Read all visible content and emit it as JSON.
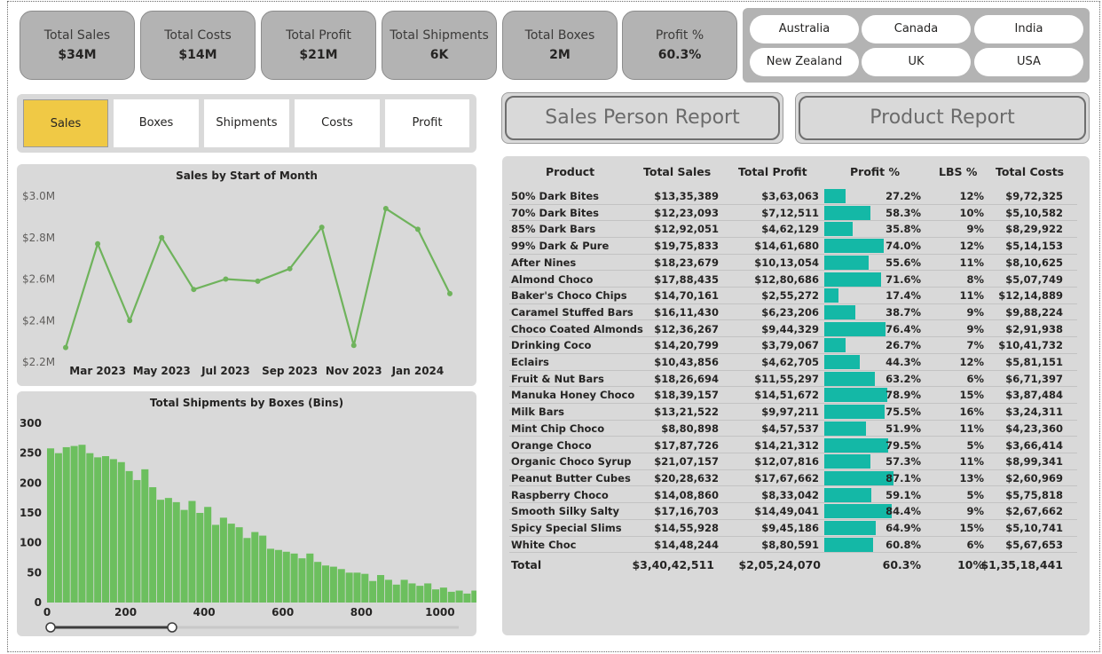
{
  "kpis": [
    {
      "label": "Total Sales",
      "value": "$34M"
    },
    {
      "label": "Total Costs",
      "value": "$14M"
    },
    {
      "label": "Total Profit",
      "value": "$21M"
    },
    {
      "label": "Total Shipments",
      "value": "6K"
    },
    {
      "label": "Total Boxes",
      "value": "2M"
    },
    {
      "label": "Profit %",
      "value": "60.3%"
    }
  ],
  "countries": [
    "Australia",
    "Canada",
    "India",
    "New Zealand",
    "UK",
    "USA"
  ],
  "metric_tabs": [
    "Sales",
    "Boxes",
    "Shipments",
    "Costs",
    "Profit"
  ],
  "active_tab": "Sales",
  "nav": {
    "sales_person": "Sales Person Report",
    "product": "Product Report"
  },
  "colors": {
    "line": "#6fb35c",
    "bar": "#6cbf5e",
    "profit_bar": "#14b8a6",
    "active_tab": "#f0c945"
  },
  "chart_data": [
    {
      "type": "line",
      "title": "Sales by Start of Month",
      "x": [
        "Feb 2023",
        "Mar 2023",
        "Apr 2023",
        "May 2023",
        "Jun 2023",
        "Jul 2023",
        "Aug 2023",
        "Sep 2023",
        "Oct 2023",
        "Nov 2023",
        "Dec 2023",
        "Jan 2024",
        "Feb 2024"
      ],
      "x_tick_labels": [
        "Mar 2023",
        "May 2023",
        "Jul 2023",
        "Sep 2023",
        "Nov 2023",
        "Jan 2024"
      ],
      "values": [
        2.27,
        2.77,
        2.4,
        2.8,
        2.55,
        2.6,
        2.59,
        2.65,
        2.85,
        2.28,
        2.94,
        2.84,
        2.53
      ],
      "y_tick_labels": [
        "$2.2M",
        "$2.4M",
        "$2.6M",
        "$2.8M",
        "$3.0M"
      ],
      "ylim": [
        2.2,
        3.0
      ],
      "grid": false
    },
    {
      "type": "bar",
      "title": "Total Shipments by Boxes (Bins)",
      "bin_width": 20,
      "x_start": 0,
      "values": [
        258,
        250,
        260,
        262,
        264,
        250,
        243,
        245,
        240,
        235,
        220,
        205,
        223,
        193,
        172,
        175,
        168,
        155,
        170,
        150,
        160,
        130,
        142,
        132,
        126,
        108,
        118,
        112,
        90,
        88,
        85,
        82,
        74,
        82,
        68,
        62,
        60,
        56,
        50,
        50,
        48,
        36,
        46,
        38,
        30,
        38,
        32,
        28,
        32,
        22,
        25,
        18,
        20,
        15,
        20,
        20,
        18,
        16,
        15,
        14,
        12,
        14,
        5,
        12
      ],
      "x_tick_labels": [
        "0",
        "200",
        "400",
        "600",
        "800",
        "1000"
      ],
      "x_ticks": [
        0,
        200,
        400,
        600,
        800,
        1000
      ],
      "y_tick_labels": [
        "0",
        "50",
        "100",
        "150",
        "200",
        "250",
        "300"
      ],
      "ylim": [
        0,
        300
      ]
    },
    {
      "type": "table",
      "columns": [
        "Product",
        "Total Sales",
        "Total Profit",
        "Profit %",
        "LBS %",
        "Total Costs"
      ],
      "rows": [
        {
          "product": "50% Dark Bites",
          "sales": "$13,35,389",
          "profit": "$3,63,063",
          "pct": "27.2%",
          "pct_val": 27.2,
          "lbs": "12%",
          "costs": "$9,72,325"
        },
        {
          "product": "70% Dark Bites",
          "sales": "$12,23,093",
          "profit": "$7,12,511",
          "pct": "58.3%",
          "pct_val": 58.3,
          "lbs": "10%",
          "costs": "$5,10,582"
        },
        {
          "product": "85% Dark Bars",
          "sales": "$12,92,051",
          "profit": "$4,62,129",
          "pct": "35.8%",
          "pct_val": 35.8,
          "lbs": "9%",
          "costs": "$8,29,922"
        },
        {
          "product": "99% Dark & Pure",
          "sales": "$19,75,833",
          "profit": "$14,61,680",
          "pct": "74.0%",
          "pct_val": 74.0,
          "lbs": "12%",
          "costs": "$5,14,153"
        },
        {
          "product": "After Nines",
          "sales": "$18,23,679",
          "profit": "$10,13,054",
          "pct": "55.6%",
          "pct_val": 55.6,
          "lbs": "11%",
          "costs": "$8,10,625"
        },
        {
          "product": "Almond Choco",
          "sales": "$17,88,435",
          "profit": "$12,80,686",
          "pct": "71.6%",
          "pct_val": 71.6,
          "lbs": "8%",
          "costs": "$5,07,749"
        },
        {
          "product": "Baker's Choco Chips",
          "sales": "$14,70,161",
          "profit": "$2,55,272",
          "pct": "17.4%",
          "pct_val": 17.4,
          "lbs": "11%",
          "costs": "$12,14,889"
        },
        {
          "product": "Caramel Stuffed Bars",
          "sales": "$16,11,430",
          "profit": "$6,23,206",
          "pct": "38.7%",
          "pct_val": 38.7,
          "lbs": "9%",
          "costs": "$9,88,224"
        },
        {
          "product": "Choco Coated Almonds",
          "sales": "$12,36,267",
          "profit": "$9,44,329",
          "pct": "76.4%",
          "pct_val": 76.4,
          "lbs": "9%",
          "costs": "$2,91,938"
        },
        {
          "product": "Drinking Coco",
          "sales": "$14,20,799",
          "profit": "$3,79,067",
          "pct": "26.7%",
          "pct_val": 26.7,
          "lbs": "7%",
          "costs": "$10,41,732"
        },
        {
          "product": "Eclairs",
          "sales": "$10,43,856",
          "profit": "$4,62,705",
          "pct": "44.3%",
          "pct_val": 44.3,
          "lbs": "12%",
          "costs": "$5,81,151"
        },
        {
          "product": "Fruit & Nut Bars",
          "sales": "$18,26,694",
          "profit": "$11,55,297",
          "pct": "63.2%",
          "pct_val": 63.2,
          "lbs": "6%",
          "costs": "$6,71,397"
        },
        {
          "product": "Manuka Honey Choco",
          "sales": "$18,39,157",
          "profit": "$14,51,672",
          "pct": "78.9%",
          "pct_val": 78.9,
          "lbs": "15%",
          "costs": "$3,87,484"
        },
        {
          "product": "Milk Bars",
          "sales": "$13,21,522",
          "profit": "$9,97,211",
          "pct": "75.5%",
          "pct_val": 75.5,
          "lbs": "16%",
          "costs": "$3,24,311"
        },
        {
          "product": "Mint Chip Choco",
          "sales": "$8,80,898",
          "profit": "$4,57,537",
          "pct": "51.9%",
          "pct_val": 51.9,
          "lbs": "11%",
          "costs": "$4,23,360"
        },
        {
          "product": "Orange Choco",
          "sales": "$17,87,726",
          "profit": "$14,21,312",
          "pct": "79.5%",
          "pct_val": 79.5,
          "lbs": "5%",
          "costs": "$3,66,414"
        },
        {
          "product": "Organic Choco Syrup",
          "sales": "$21,07,157",
          "profit": "$12,07,816",
          "pct": "57.3%",
          "pct_val": 57.3,
          "lbs": "11%",
          "costs": "$8,99,341"
        },
        {
          "product": "Peanut Butter Cubes",
          "sales": "$20,28,632",
          "profit": "$17,67,662",
          "pct": "87.1%",
          "pct_val": 87.1,
          "lbs": "13%",
          "costs": "$2,60,969"
        },
        {
          "product": "Raspberry Choco",
          "sales": "$14,08,860",
          "profit": "$8,33,042",
          "pct": "59.1%",
          "pct_val": 59.1,
          "lbs": "5%",
          "costs": "$5,75,818"
        },
        {
          "product": "Smooth Silky Salty",
          "sales": "$17,16,703",
          "profit": "$14,49,041",
          "pct": "84.4%",
          "pct_val": 84.4,
          "lbs": "9%",
          "costs": "$2,67,662"
        },
        {
          "product": "Spicy Special Slims",
          "sales": "$14,55,928",
          "profit": "$9,45,186",
          "pct": "64.9%",
          "pct_val": 64.9,
          "lbs": "15%",
          "costs": "$5,10,741"
        },
        {
          "product": "White Choc",
          "sales": "$14,48,244",
          "profit": "$8,80,591",
          "pct": "60.8%",
          "pct_val": 60.8,
          "lbs": "6%",
          "costs": "$5,67,653"
        }
      ],
      "total": {
        "label": "Total",
        "sales": "$3,40,42,511",
        "profit": "$2,05,24,070",
        "pct": "60.3%",
        "lbs": "10%",
        "costs": "$1,35,18,441"
      }
    }
  ]
}
